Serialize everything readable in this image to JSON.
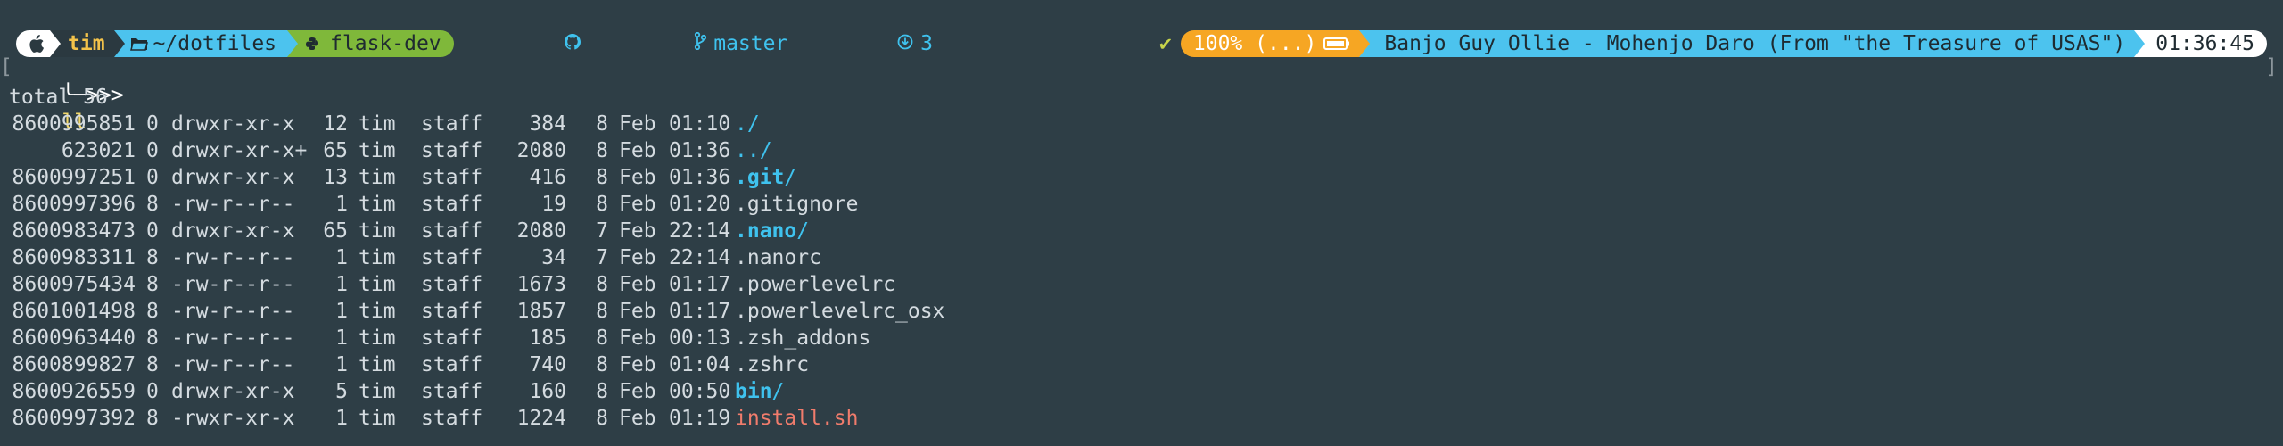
{
  "prompt": {
    "user": "tim",
    "path": "~/dotfiles",
    "virtualenv": "flask-dev",
    "vcs_branch": "master",
    "vcs_count": "3",
    "status_ok": "✔",
    "battery": "100% (...)",
    "now_playing": "Banjo Guy Ollie - Mohenjo Daro (From \"the Treasure of USAS\")",
    "clock": "01:36:45",
    "prompt_symbol": "╰─>>>",
    "command": "ll",
    "bracket_left": "[",
    "bracket_right": "]"
  },
  "listing": {
    "total_line": "total 56",
    "rows": [
      {
        "inode": "8600995851",
        "blocks": "0",
        "perm": "drwxr-xr-x",
        "links": "12",
        "user": "tim",
        "group": "staff",
        "size": "384",
        "day": "8",
        "mon": "Feb",
        "time": "01:10",
        "name": ".",
        "suffix": "/",
        "kind": "dot"
      },
      {
        "inode": "623021",
        "blocks": "0",
        "perm": "drwxr-xr-x+",
        "links": "65",
        "user": "tim",
        "group": "staff",
        "size": "2080",
        "day": "8",
        "mon": "Feb",
        "time": "01:36",
        "name": "..",
        "suffix": "/",
        "kind": "dot"
      },
      {
        "inode": "8600997251",
        "blocks": "0",
        "perm": "drwxr-xr-x",
        "links": "13",
        "user": "tim",
        "group": "staff",
        "size": "416",
        "day": "8",
        "mon": "Feb",
        "time": "01:36",
        "name": ".git",
        "suffix": "/",
        "kind": "dir"
      },
      {
        "inode": "8600997396",
        "blocks": "8",
        "perm": "-rw-r--r--",
        "links": "1",
        "user": "tim",
        "group": "staff",
        "size": "19",
        "day": "8",
        "mon": "Feb",
        "time": "01:20",
        "name": ".gitignore",
        "suffix": "",
        "kind": "file"
      },
      {
        "inode": "8600983473",
        "blocks": "0",
        "perm": "drwxr-xr-x",
        "links": "65",
        "user": "tim",
        "group": "staff",
        "size": "2080",
        "day": "7",
        "mon": "Feb",
        "time": "22:14",
        "name": ".nano",
        "suffix": "/",
        "kind": "dir"
      },
      {
        "inode": "8600983311",
        "blocks": "8",
        "perm": "-rw-r--r--",
        "links": "1",
        "user": "tim",
        "group": "staff",
        "size": "34",
        "day": "7",
        "mon": "Feb",
        "time": "22:14",
        "name": ".nanorc",
        "suffix": "",
        "kind": "file"
      },
      {
        "inode": "8600975434",
        "blocks": "8",
        "perm": "-rw-r--r--",
        "links": "1",
        "user": "tim",
        "group": "staff",
        "size": "1673",
        "day": "8",
        "mon": "Feb",
        "time": "01:17",
        "name": ".powerlevelrc",
        "suffix": "",
        "kind": "file"
      },
      {
        "inode": "8601001498",
        "blocks": "8",
        "perm": "-rw-r--r--",
        "links": "1",
        "user": "tim",
        "group": "staff",
        "size": "1857",
        "day": "8",
        "mon": "Feb",
        "time": "01:17",
        "name": ".powerlevelrc_osx",
        "suffix": "",
        "kind": "file"
      },
      {
        "inode": "8600963440",
        "blocks": "8",
        "perm": "-rw-r--r--",
        "links": "1",
        "user": "tim",
        "group": "staff",
        "size": "185",
        "day": "8",
        "mon": "Feb",
        "time": "00:13",
        "name": ".zsh_addons",
        "suffix": "",
        "kind": "file"
      },
      {
        "inode": "8600899827",
        "blocks": "8",
        "perm": "-rw-r--r--",
        "links": "1",
        "user": "tim",
        "group": "staff",
        "size": "740",
        "day": "8",
        "mon": "Feb",
        "time": "01:04",
        "name": ".zshrc",
        "suffix": "",
        "kind": "file"
      },
      {
        "inode": "8600926559",
        "blocks": "0",
        "perm": "drwxr-xr-x",
        "links": "5",
        "user": "tim",
        "group": "staff",
        "size": "160",
        "day": "8",
        "mon": "Feb",
        "time": "00:50",
        "name": "bin",
        "suffix": "/",
        "kind": "dir"
      },
      {
        "inode": "8600997392",
        "blocks": "8",
        "perm": "-rwxr-xr-x",
        "links": "1",
        "user": "tim",
        "group": "staff",
        "size": "1224",
        "day": "8",
        "mon": "Feb",
        "time": "01:19",
        "name": "install.sh",
        "suffix": "",
        "kind": "exec"
      }
    ]
  },
  "colors": {
    "background": "#2e3e46",
    "os_segment": "#ffffff",
    "user_segment": "#2b3940",
    "user_text": "#f3c24a",
    "path_segment": "#4cc3ee",
    "venv_segment": "#7fb83a",
    "vcs_text": "#3fc2ee",
    "status_ok": "#c7d44a",
    "battery_segment": "#f6a623",
    "song_segment": "#4cc3ee",
    "clock_segment": "#ffffff",
    "dir_color": "#3fc2ee",
    "exec_color": "#f07c6c"
  },
  "icons": {
    "os": "apple-icon",
    "path": "folder-icon",
    "venv": "python-icon",
    "vcs": "github-icon",
    "branch": "git-branch-icon",
    "count": "arrow-circle-icon",
    "battery": "battery-icon"
  }
}
